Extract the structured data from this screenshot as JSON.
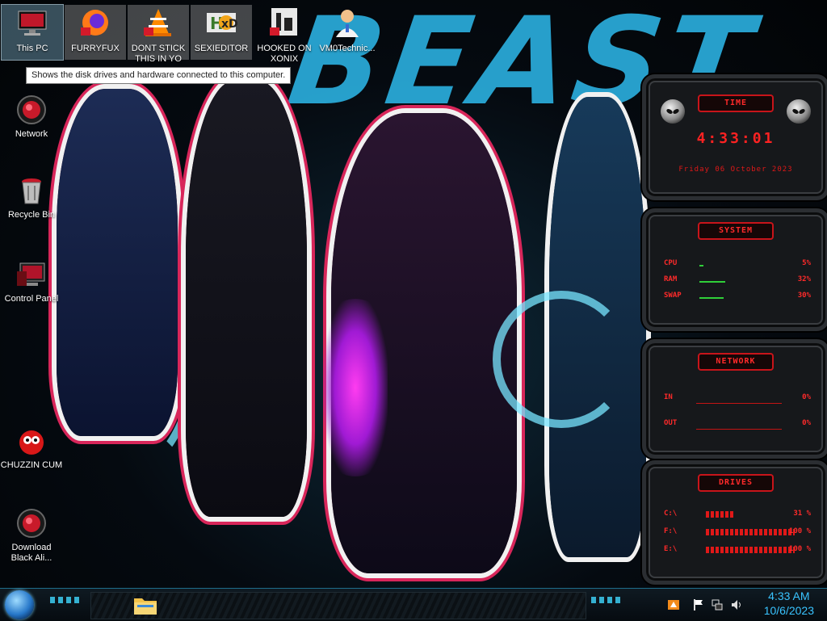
{
  "desktop": {
    "top_icons": [
      {
        "label": "This PC",
        "icon": "computer-icon"
      },
      {
        "label": "FURRYFUX",
        "icon": "firefox-icon"
      },
      {
        "label": "DONT STICK THIS IN YO",
        "icon": "vlc-icon"
      },
      {
        "label": "SEXIEDITOR",
        "icon": "editor-icon"
      },
      {
        "label": "HOOKED ON XONIX",
        "icon": "game-icon"
      },
      {
        "label": "VM0Technic...",
        "icon": "doctor-icon"
      }
    ],
    "tooltip": "Shows the disk drives and hardware connected to this computer.",
    "left_icons": [
      {
        "label": "Network",
        "icon": "network-icon"
      },
      {
        "label": "Recycle Bin",
        "icon": "recycle-bin-icon"
      },
      {
        "label": "Control Panel",
        "icon": "control-panel-icon"
      },
      {
        "label": "CHUZZIN CUM",
        "icon": "chuzzle-icon"
      },
      {
        "label": "Download Black Ali...",
        "icon": "download-icon"
      }
    ]
  },
  "wallpaper": {
    "title_text": "BEAST"
  },
  "gadgets": {
    "time": {
      "header": "TIME",
      "clock": "4:33:01",
      "date": "Friday 06 October 2023"
    },
    "system": {
      "header": "SYSTEM",
      "rows": [
        {
          "label": "CPU",
          "value": "5%",
          "level": 0.05
        },
        {
          "label": "RAM",
          "value": "32%",
          "level": 0.32
        },
        {
          "label": "SWAP",
          "value": "30%",
          "level": 0.3
        }
      ]
    },
    "network": {
      "header": "NETWORK",
      "rows": [
        {
          "label": "IN",
          "value": "0%"
        },
        {
          "label": "OUT",
          "value": "0%"
        }
      ]
    },
    "drives": {
      "header": "DRIVES",
      "rows": [
        {
          "label": "C:\\",
          "value": "31 %",
          "level": 0.31
        },
        {
          "label": "F:\\",
          "value": "100 %",
          "level": 1.0
        },
        {
          "label": "E:\\",
          "value": "100 %",
          "level": 1.0
        }
      ]
    }
  },
  "taskbar": {
    "time": "4:33 AM",
    "date": "10/6/2023",
    "tray_icons": [
      "shield-flag-icon",
      "action-center-flag-icon",
      "network-tray-icon",
      "speaker-icon"
    ]
  },
  "colors": {
    "accent_red": "#ff2222",
    "accent_blue": "#39c3ff",
    "wallpaper_cyan": "#29a8d6",
    "meter_green": "#2fcf39"
  }
}
